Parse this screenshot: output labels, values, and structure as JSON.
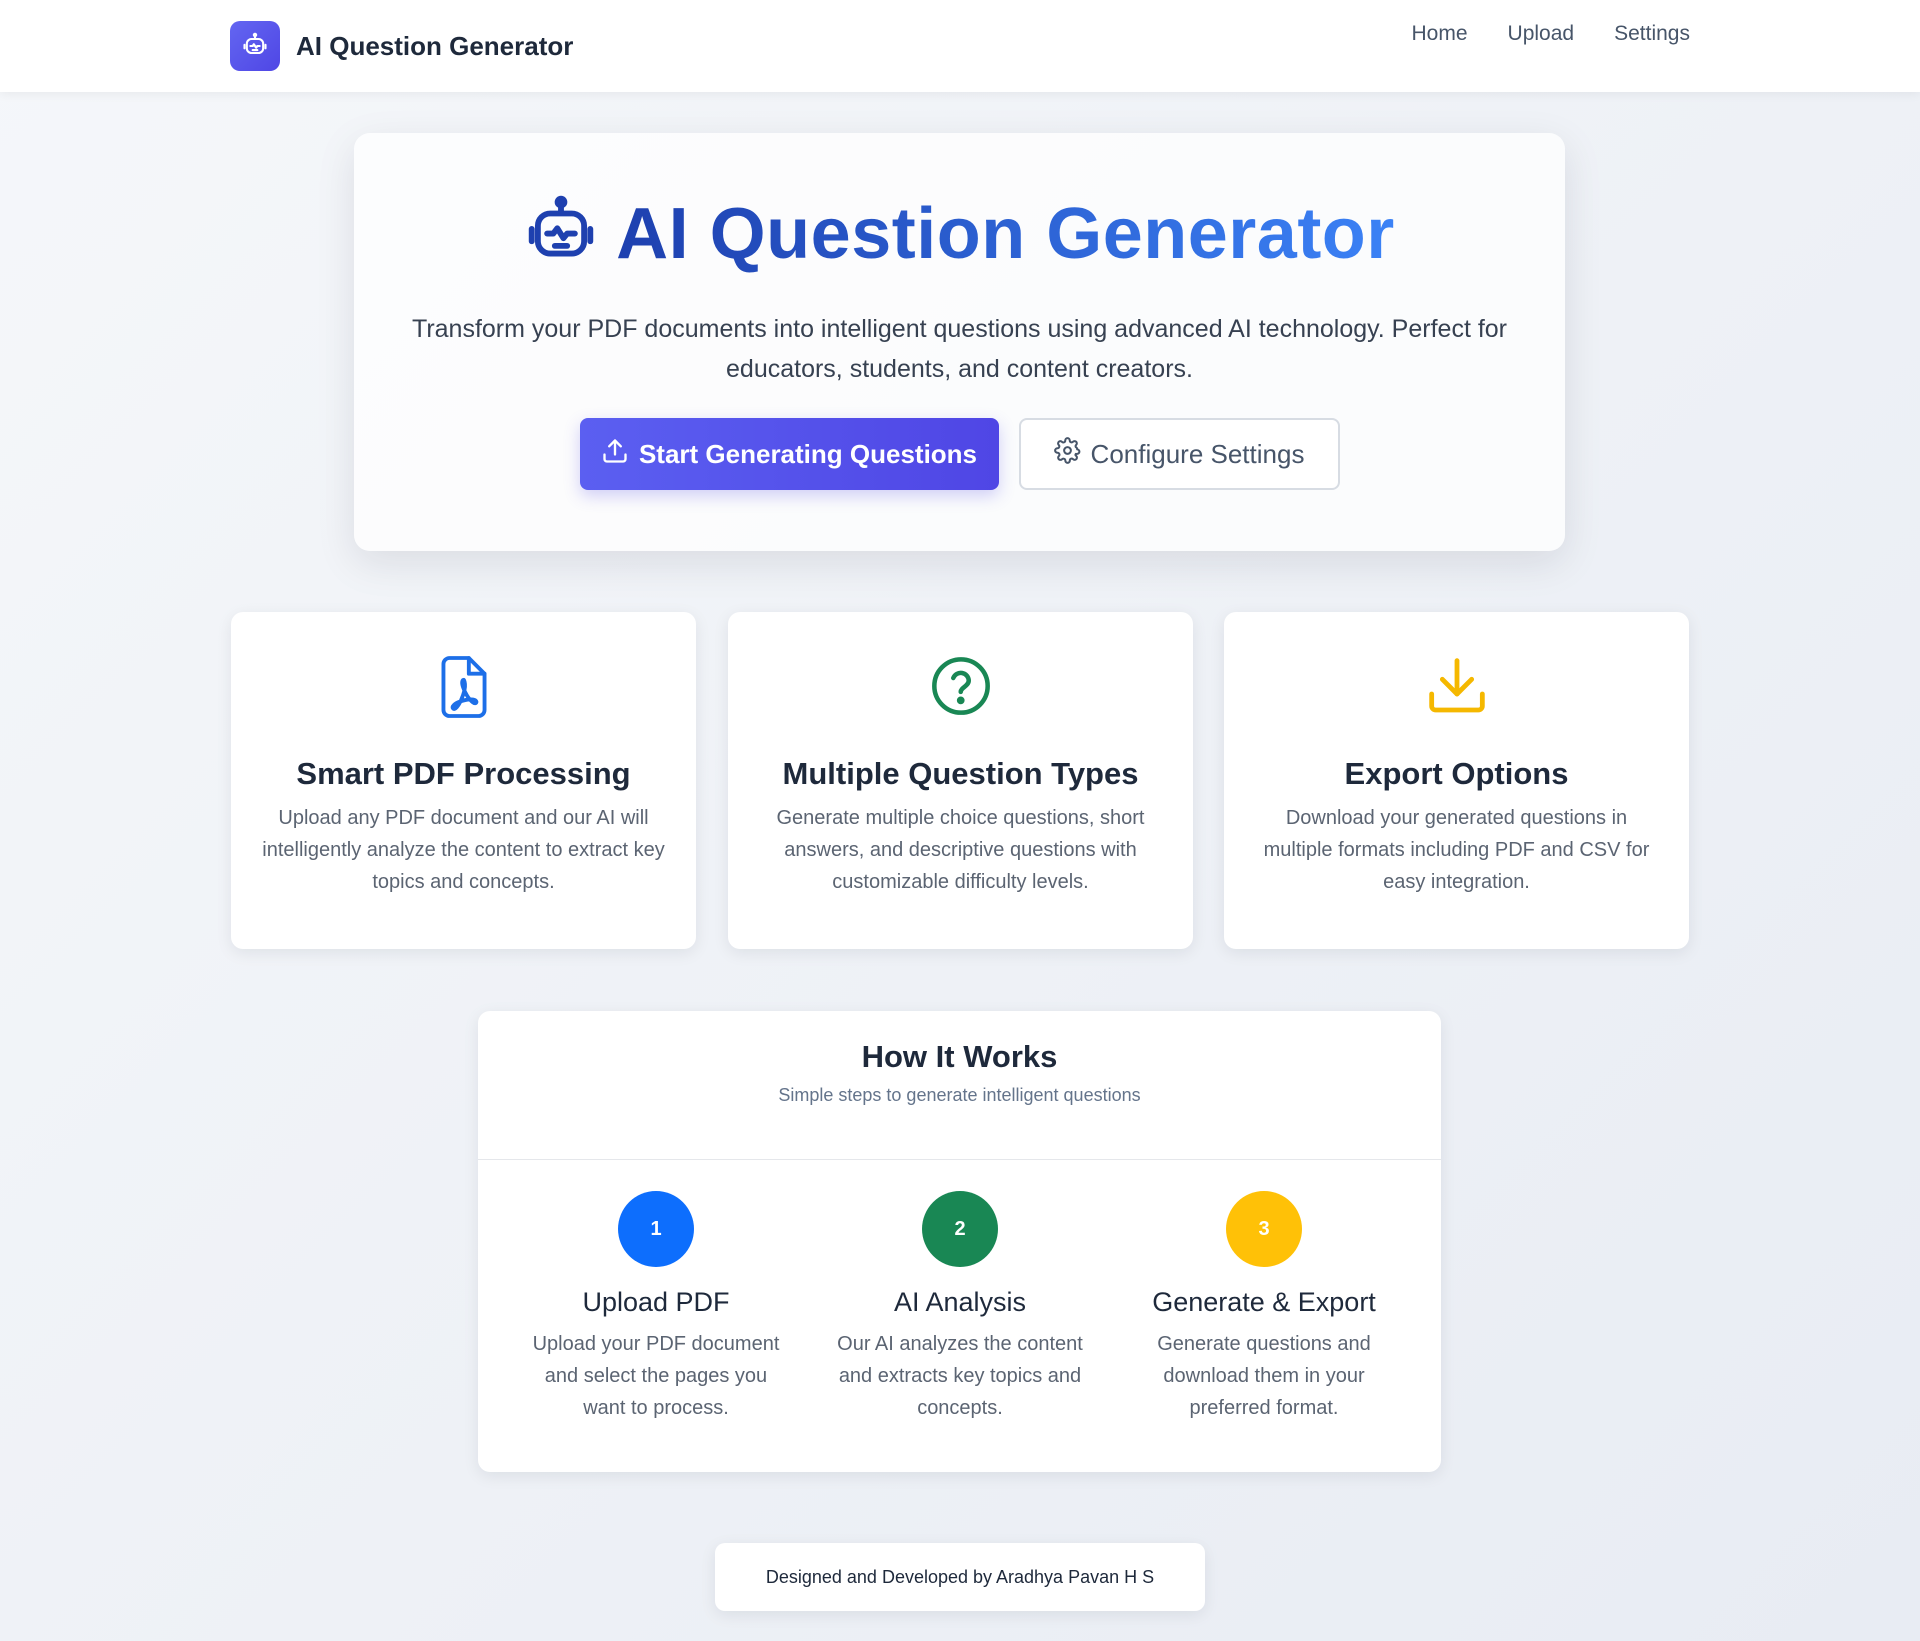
{
  "nav": {
    "brand_title": "AI Question Generator",
    "brand_icon": "robot-icon",
    "links": [
      "Home",
      "Upload",
      "Settings"
    ]
  },
  "hero": {
    "title": "AI Question Generator",
    "subtitle": "Transform your PDF documents into intelligent questions using advanced AI technology. Perfect for educators, students, and content creators.",
    "primary_button": "Start Generating Questions",
    "secondary_button": "Configure Settings"
  },
  "features": [
    {
      "icon": "pdf-file-icon",
      "color": "#1d6fe8",
      "title": "Smart PDF Processing",
      "description": "Upload any PDF document and our AI will intelligently analyze the content to extract key topics and concepts."
    },
    {
      "icon": "question-circle-icon",
      "color": "#198754",
      "title": "Multiple Question Types",
      "description": "Generate multiple choice questions, short answers, and descriptive questions with customizable difficulty levels."
    },
    {
      "icon": "download-icon",
      "color": "#f5b800",
      "title": "Export Options",
      "description": "Download your generated questions in multiple formats including PDF and CSV for easy integration."
    }
  ],
  "how_it_works": {
    "title": "How It Works",
    "subtitle": "Simple steps to generate intelligent questions",
    "steps": [
      {
        "number": "1",
        "color": "#0d6efd",
        "title": "Upload PDF",
        "description": "Upload your PDF document and select the pages you want to process."
      },
      {
        "number": "2",
        "color": "#198754",
        "title": "AI Analysis",
        "description": "Our AI analyzes the content and extracts key topics and concepts."
      },
      {
        "number": "3",
        "color": "#ffc107",
        "title": "Generate & Export",
        "description": "Generate questions and download them in your preferred format."
      }
    ]
  },
  "footer": {
    "text": "Designed and Developed by Aradhya Pavan H S"
  }
}
